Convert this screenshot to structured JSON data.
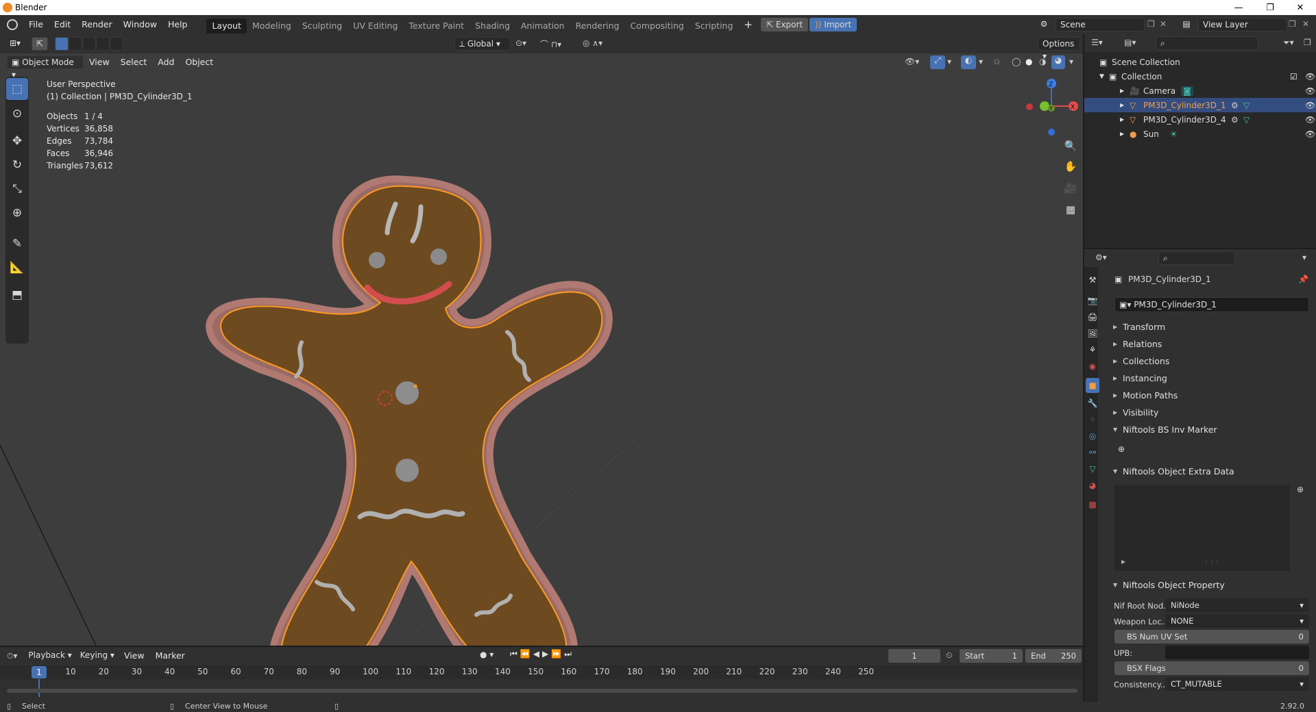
{
  "app": {
    "title": "Blender",
    "version": "2.92.0"
  },
  "menu": {
    "items": [
      "File",
      "Edit",
      "Render",
      "Window",
      "Help"
    ]
  },
  "workspaces": {
    "tabs": [
      "Layout",
      "Modeling",
      "Sculpting",
      "UV Editing",
      "Texture Paint",
      "Shading",
      "Animation",
      "Rendering",
      "Compositing",
      "Scripting"
    ],
    "active": "Layout"
  },
  "topbar": {
    "export_label": "Export",
    "import_label": "Import",
    "scene": "Scene",
    "view_layer": "View Layer"
  },
  "viewport": {
    "transform_orientation": "Global",
    "options_label": "Options",
    "mode": "Object Mode",
    "menus": [
      "View",
      "Select",
      "Add",
      "Object"
    ],
    "overlay_title": "User Perspective",
    "overlay_sub": "(1) Collection | PM3D_Cylinder3D_1",
    "stats": [
      {
        "label": "Objects",
        "value": "1 / 4"
      },
      {
        "label": "Vertices",
        "value": "36,858"
      },
      {
        "label": "Edges",
        "value": "73,784"
      },
      {
        "label": "Faces",
        "value": "36,946"
      },
      {
        "label": "Triangles",
        "value": "73,612"
      }
    ],
    "gizmo": {
      "z": "Z",
      "y": "Y",
      "x": "X"
    }
  },
  "timeline": {
    "menus": [
      "Playback",
      "Keying",
      "View",
      "Marker"
    ],
    "current_frame": "1",
    "start_label": "Start",
    "start": "1",
    "end_label": "End",
    "end": "250",
    "ticks": [
      "1",
      "10",
      "20",
      "30",
      "40",
      "50",
      "60",
      "70",
      "80",
      "90",
      "100",
      "110",
      "120",
      "130",
      "140",
      "150",
      "160",
      "170",
      "180",
      "190",
      "200",
      "210",
      "220",
      "230",
      "240",
      "250"
    ]
  },
  "status": {
    "select": "Select",
    "center_view": "Center View to Mouse",
    "version": "2.92.0"
  },
  "outliner": {
    "root": "Scene Collection",
    "collection": "Collection",
    "items": [
      {
        "name": "Camera",
        "selected": false
      },
      {
        "name": "PM3D_Cylinder3D_1",
        "selected": true
      },
      {
        "name": "PM3D_Cylinder3D_4",
        "selected": false
      },
      {
        "name": "Sun",
        "selected": false
      }
    ]
  },
  "properties": {
    "object_name": "PM3D_Cylinder3D_1",
    "name_field": "PM3D_Cylinder3D_1",
    "panels": [
      "Transform",
      "Relations",
      "Collections",
      "Instancing",
      "Motion Paths",
      "Visibility",
      "Niftools BS Inv Marker"
    ],
    "extra_data_panel": "Niftools Object Extra Data",
    "property_panel": "Niftools Object Property",
    "fields": {
      "nif_root_label": "Nif Root Nod...",
      "nif_root_value": "NiNode",
      "weapon_label": "Weapon Loc...",
      "weapon_value": "NONE",
      "bs_num_uv_label": "BS Num UV Set",
      "bs_num_uv_value": "0",
      "upb_label": "UPB:",
      "upb_value": "",
      "bsx_label": "BSX Flags",
      "bsx_value": "0",
      "consistency_label": "Consistency...",
      "consistency_value": "CT_MUTABLE"
    }
  },
  "colors": {
    "accent": "#4772b3",
    "selection": "#ff9a1f",
    "cookie": "#6e4a20",
    "icing": "#9b6f6c"
  }
}
